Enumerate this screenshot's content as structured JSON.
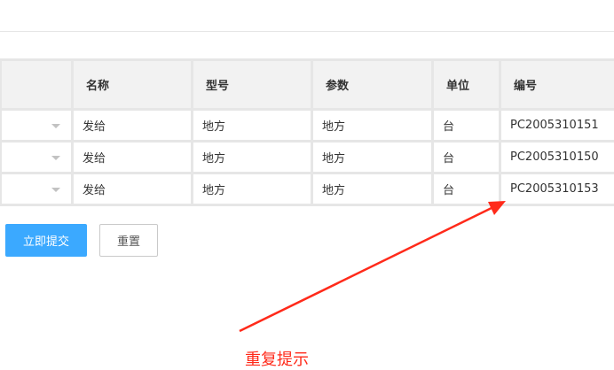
{
  "table": {
    "headers": [
      "",
      "名称",
      "型号",
      "参数",
      "单位",
      "编号"
    ],
    "rows": [
      [
        "",
        "发给",
        "地方",
        "地方",
        "台",
        "PC2005310151"
      ],
      [
        "",
        "发给",
        "地方",
        "地方",
        "台",
        "PC2005310150"
      ],
      [
        "",
        "发给",
        "地方",
        "地方",
        "台",
        "PC2005310153"
      ]
    ]
  },
  "buttons": {
    "submit": "立即提交",
    "reset": "重置"
  },
  "annotation": {
    "text": "重复提示",
    "color": "#ff2a1a"
  }
}
